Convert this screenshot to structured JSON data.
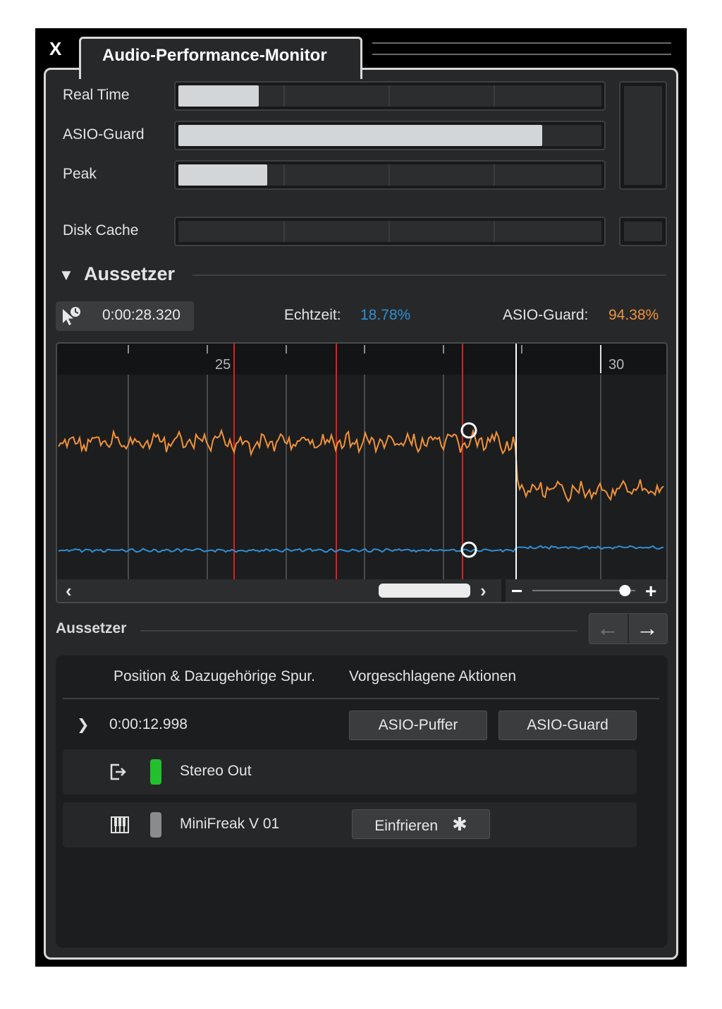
{
  "window": {
    "close_glyph": "X",
    "title": "Audio-Performance-Monitor"
  },
  "meters": [
    {
      "label": "Real Time",
      "level": 0.19
    },
    {
      "label": "ASIO-Guard",
      "level": 0.86
    },
    {
      "label": "Peak",
      "level": 0.21
    },
    {
      "label": "Disk Cache",
      "level": 0.0
    }
  ],
  "dropouts_section": {
    "title": "Aussetzer",
    "collapse_glyph": "▼",
    "time": "0:00:28.320",
    "realtime_label": "Echtzeit:",
    "realtime_value": "18.78%",
    "asioguard_label": "ASIO-Guard:",
    "asioguard_value": "94.38%",
    "colors": {
      "realtime": "#2f8fd6",
      "asioguard": "#f0923a",
      "dropout_marker": "#e01e1e"
    }
  },
  "timeline": {
    "ruler_labels": [
      "25",
      "30"
    ],
    "scroll_left_glyph": "‹",
    "scroll_right_glyph": "›",
    "zoom_out_glyph": "−",
    "zoom_in_glyph": "+",
    "zoom_level": 0.9
  },
  "list_section": {
    "title": "Aussetzer",
    "prev_glyph": "←",
    "next_glyph": "→",
    "col_position": "Position & Dazugehörige Spur.",
    "col_actions": "Vorgeschlagene Aktionen",
    "entry": {
      "expand_glyph": "❯",
      "time": "0:00:12.998",
      "action1": "ASIO-Puffer",
      "action2": "ASIO-Guard"
    },
    "tracks": [
      {
        "name": "Stereo Out",
        "indicator_color": "#22c02c",
        "icon": "output-icon"
      },
      {
        "name": "MiniFreak V 01",
        "indicator_color": "#8a8b8d",
        "icon": "piano-keys-icon",
        "action": "Einfrieren",
        "action_glyph": "✱"
      }
    ]
  }
}
